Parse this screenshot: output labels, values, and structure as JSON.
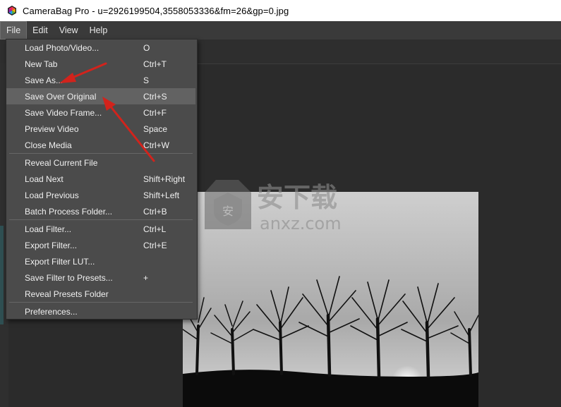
{
  "window": {
    "title": "CameraBag Pro - u=2926199504,3558053336&fm=26&gp=0.jpg"
  },
  "menubar": {
    "items": [
      "File",
      "Edit",
      "View",
      "Help"
    ]
  },
  "file_menu": {
    "items": [
      {
        "label": "Load Photo/Video...",
        "shortcut": "O"
      },
      {
        "label": "New Tab",
        "shortcut": "Ctrl+T"
      },
      {
        "label": "Save As...",
        "shortcut": "S"
      },
      {
        "label": "Save Over Original",
        "shortcut": "Ctrl+S"
      },
      {
        "label": "Save Video Frame...",
        "shortcut": "Ctrl+F"
      },
      {
        "label": "Preview Video",
        "shortcut": "Space"
      },
      {
        "label": "Close Media",
        "shortcut": "Ctrl+W"
      },
      {
        "label": "Reveal Current File",
        "shortcut": ""
      },
      {
        "label": "Load Next",
        "shortcut": "Shift+Right"
      },
      {
        "label": "Load Previous",
        "shortcut": "Shift+Left"
      },
      {
        "label": "Batch Process Folder...",
        "shortcut": "Ctrl+B"
      },
      {
        "label": "Load Filter...",
        "shortcut": "Ctrl+L"
      },
      {
        "label": "Export Filter...",
        "shortcut": "Ctrl+E"
      },
      {
        "label": "Export Filter LUT...",
        "shortcut": ""
      },
      {
        "label": "Save Filter to Presets...",
        "shortcut": "+"
      },
      {
        "label": "Reveal Presets Folder",
        "shortcut": ""
      },
      {
        "label": "Preferences...",
        "shortcut": ""
      }
    ]
  },
  "watermark": {
    "main": "安下载",
    "sub": "anxz.com"
  },
  "colors": {
    "menubar": "#3a3a3a",
    "dropdown": "#4b4b4b",
    "highlight": "#626262",
    "arrow": "#d2231c"
  }
}
